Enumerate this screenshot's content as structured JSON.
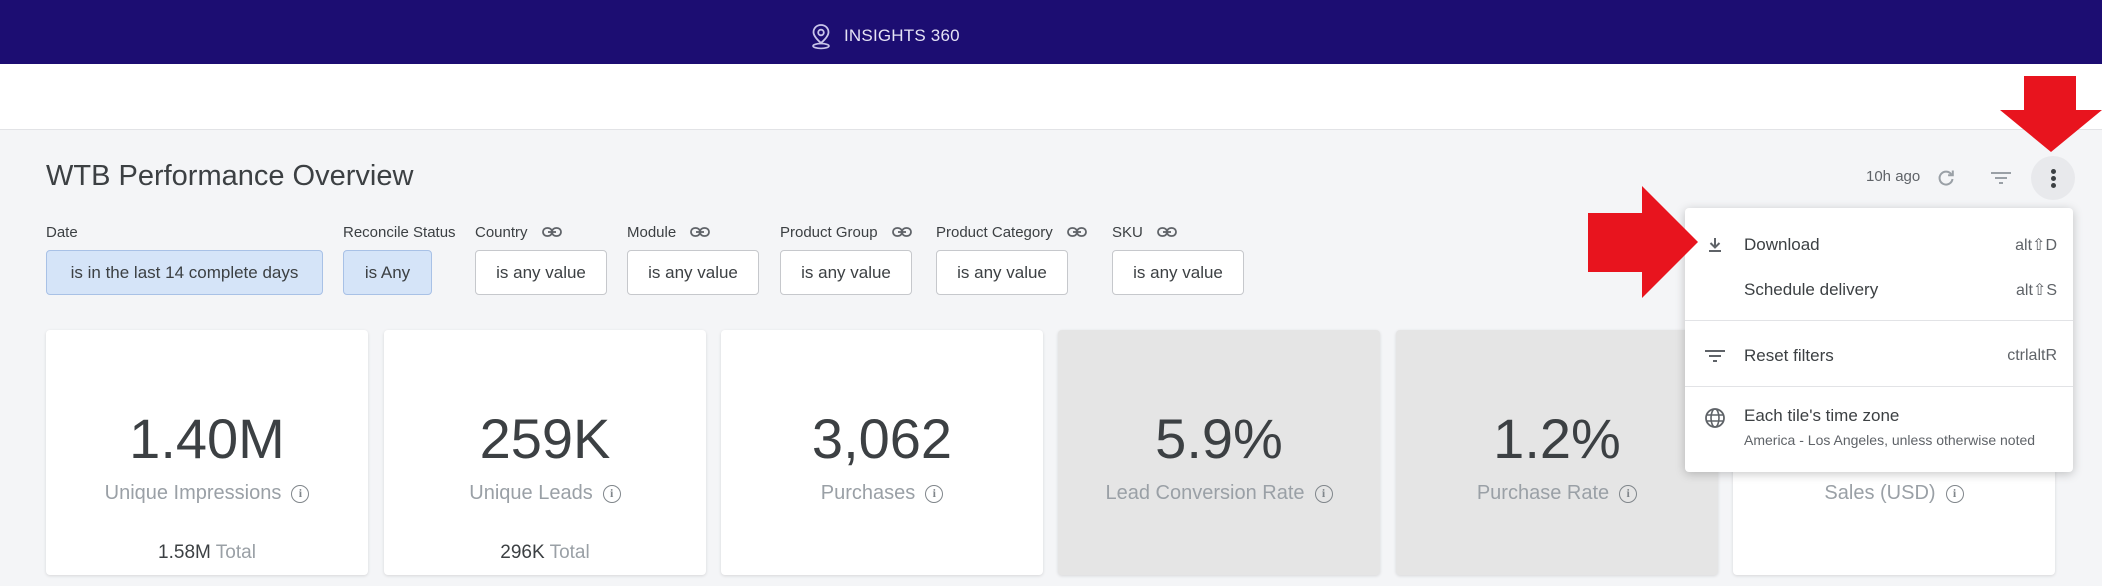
{
  "app": {
    "brand": "INSIGHTS 360"
  },
  "dashboard": {
    "title": "WTB Performance Overview",
    "updated": "10h ago"
  },
  "filters": [
    {
      "label": "Date",
      "value": "is in the last 14 complete days",
      "active": true,
      "linked": false
    },
    {
      "label": "Reconcile Status",
      "value": "is Any",
      "active": true,
      "linked": false
    },
    {
      "label": "Country",
      "value": "is any value",
      "active": false,
      "linked": true
    },
    {
      "label": "Module",
      "value": "is any value",
      "active": false,
      "linked": true
    },
    {
      "label": "Product Group",
      "value": "is any value",
      "active": false,
      "linked": true
    },
    {
      "label": "Product Category",
      "value": "is any value",
      "active": false,
      "linked": true
    },
    {
      "label": "SKU",
      "value": "is any value",
      "active": false,
      "linked": true
    }
  ],
  "tiles": [
    {
      "value": "1.40M",
      "label": "Unique Impressions",
      "total_value": "1.58M",
      "total_word": "Total"
    },
    {
      "value": "259K",
      "label": "Unique Leads",
      "total_value": "296K",
      "total_word": "Total"
    },
    {
      "value": "3,062",
      "label": "Purchases"
    },
    {
      "value": "5.9%",
      "label": "Lead Conversion Rate"
    },
    {
      "value": "1.2%",
      "label": "Purchase Rate"
    },
    {
      "value": "",
      "label": "Sales (USD)"
    }
  ],
  "menu": {
    "items": [
      {
        "label": "Download",
        "shortcut": "alt⇧D",
        "icon": "download-icon"
      },
      {
        "label": "Schedule delivery",
        "shortcut": "alt⇧S"
      },
      {
        "label": "Reset filters",
        "shortcut": "ctrlaltR",
        "icon": "filter-lines-icon"
      },
      {
        "label": "Each tile's time zone",
        "sub": "America - Los Angeles, unless otherwise noted",
        "icon": "globe-icon"
      }
    ]
  },
  "colors": {
    "topbar": "#1c0d72",
    "active_filter": "#d5e4f8",
    "annotation_arrow": "#e8141e"
  }
}
